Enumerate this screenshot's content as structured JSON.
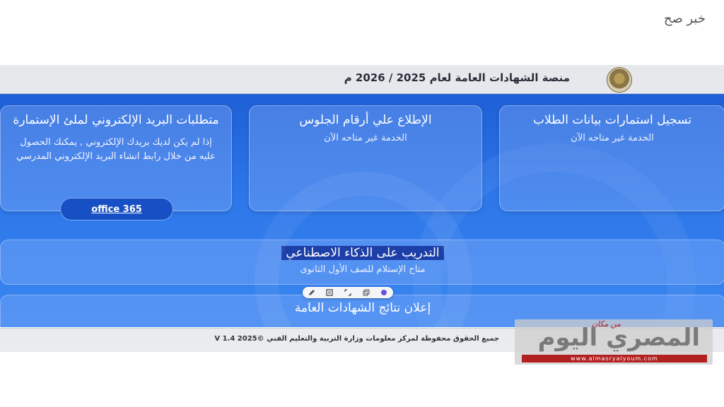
{
  "corner_tag": "خبر صح",
  "header": {
    "platform_title": "منصة الشهادات العامة لعام 2025 / 2026 م",
    "logo_icon": "ministry-seal-icon"
  },
  "cards": {
    "students": {
      "title": "تسجيل استمارات بيانات الطلاب",
      "status": "الخدمة غير متاحه الآن"
    },
    "seats": {
      "title": "الإطلاع علي أرقام الجلوس",
      "status": "الخدمة غير متاحه الآن"
    },
    "email": {
      "title": "متطلبات البريد الإلكتروني لملئ الإستمارة",
      "description": "إذا لم يكن لديك بريدك الإلكتروني , يمكنك الحصول عليه من خلال رابط انشاء البريد الإلكتروني المدرسي",
      "button_label": "office 365"
    }
  },
  "ai_training": {
    "title": "التدريب على الذكاء الاصطناعي",
    "subtitle": "متاح الإستلام للصف الأول الثانوى"
  },
  "results": {
    "title": "إعلان نتائج الشهادات العامة"
  },
  "toolbar": {
    "icons": [
      "pencil-icon",
      "translate-icon",
      "expand-icon",
      "copy-icon",
      "assistant-icon"
    ]
  },
  "footer": {
    "copyright": "جميع الحقوق محفوظة لمركز معلومات وزارة التربية والتعليم الفني ©2025 V 1.4"
  },
  "watermark": {
    "name": "المصري اليوم",
    "tagline": "من مكان",
    "url": "www.almasryalyoum.com"
  },
  "colors": {
    "primary_blue": "#2d77ea",
    "header_gray": "#e6e8ec",
    "button_blue": "#174fc4",
    "watermark_red": "#b32020"
  }
}
